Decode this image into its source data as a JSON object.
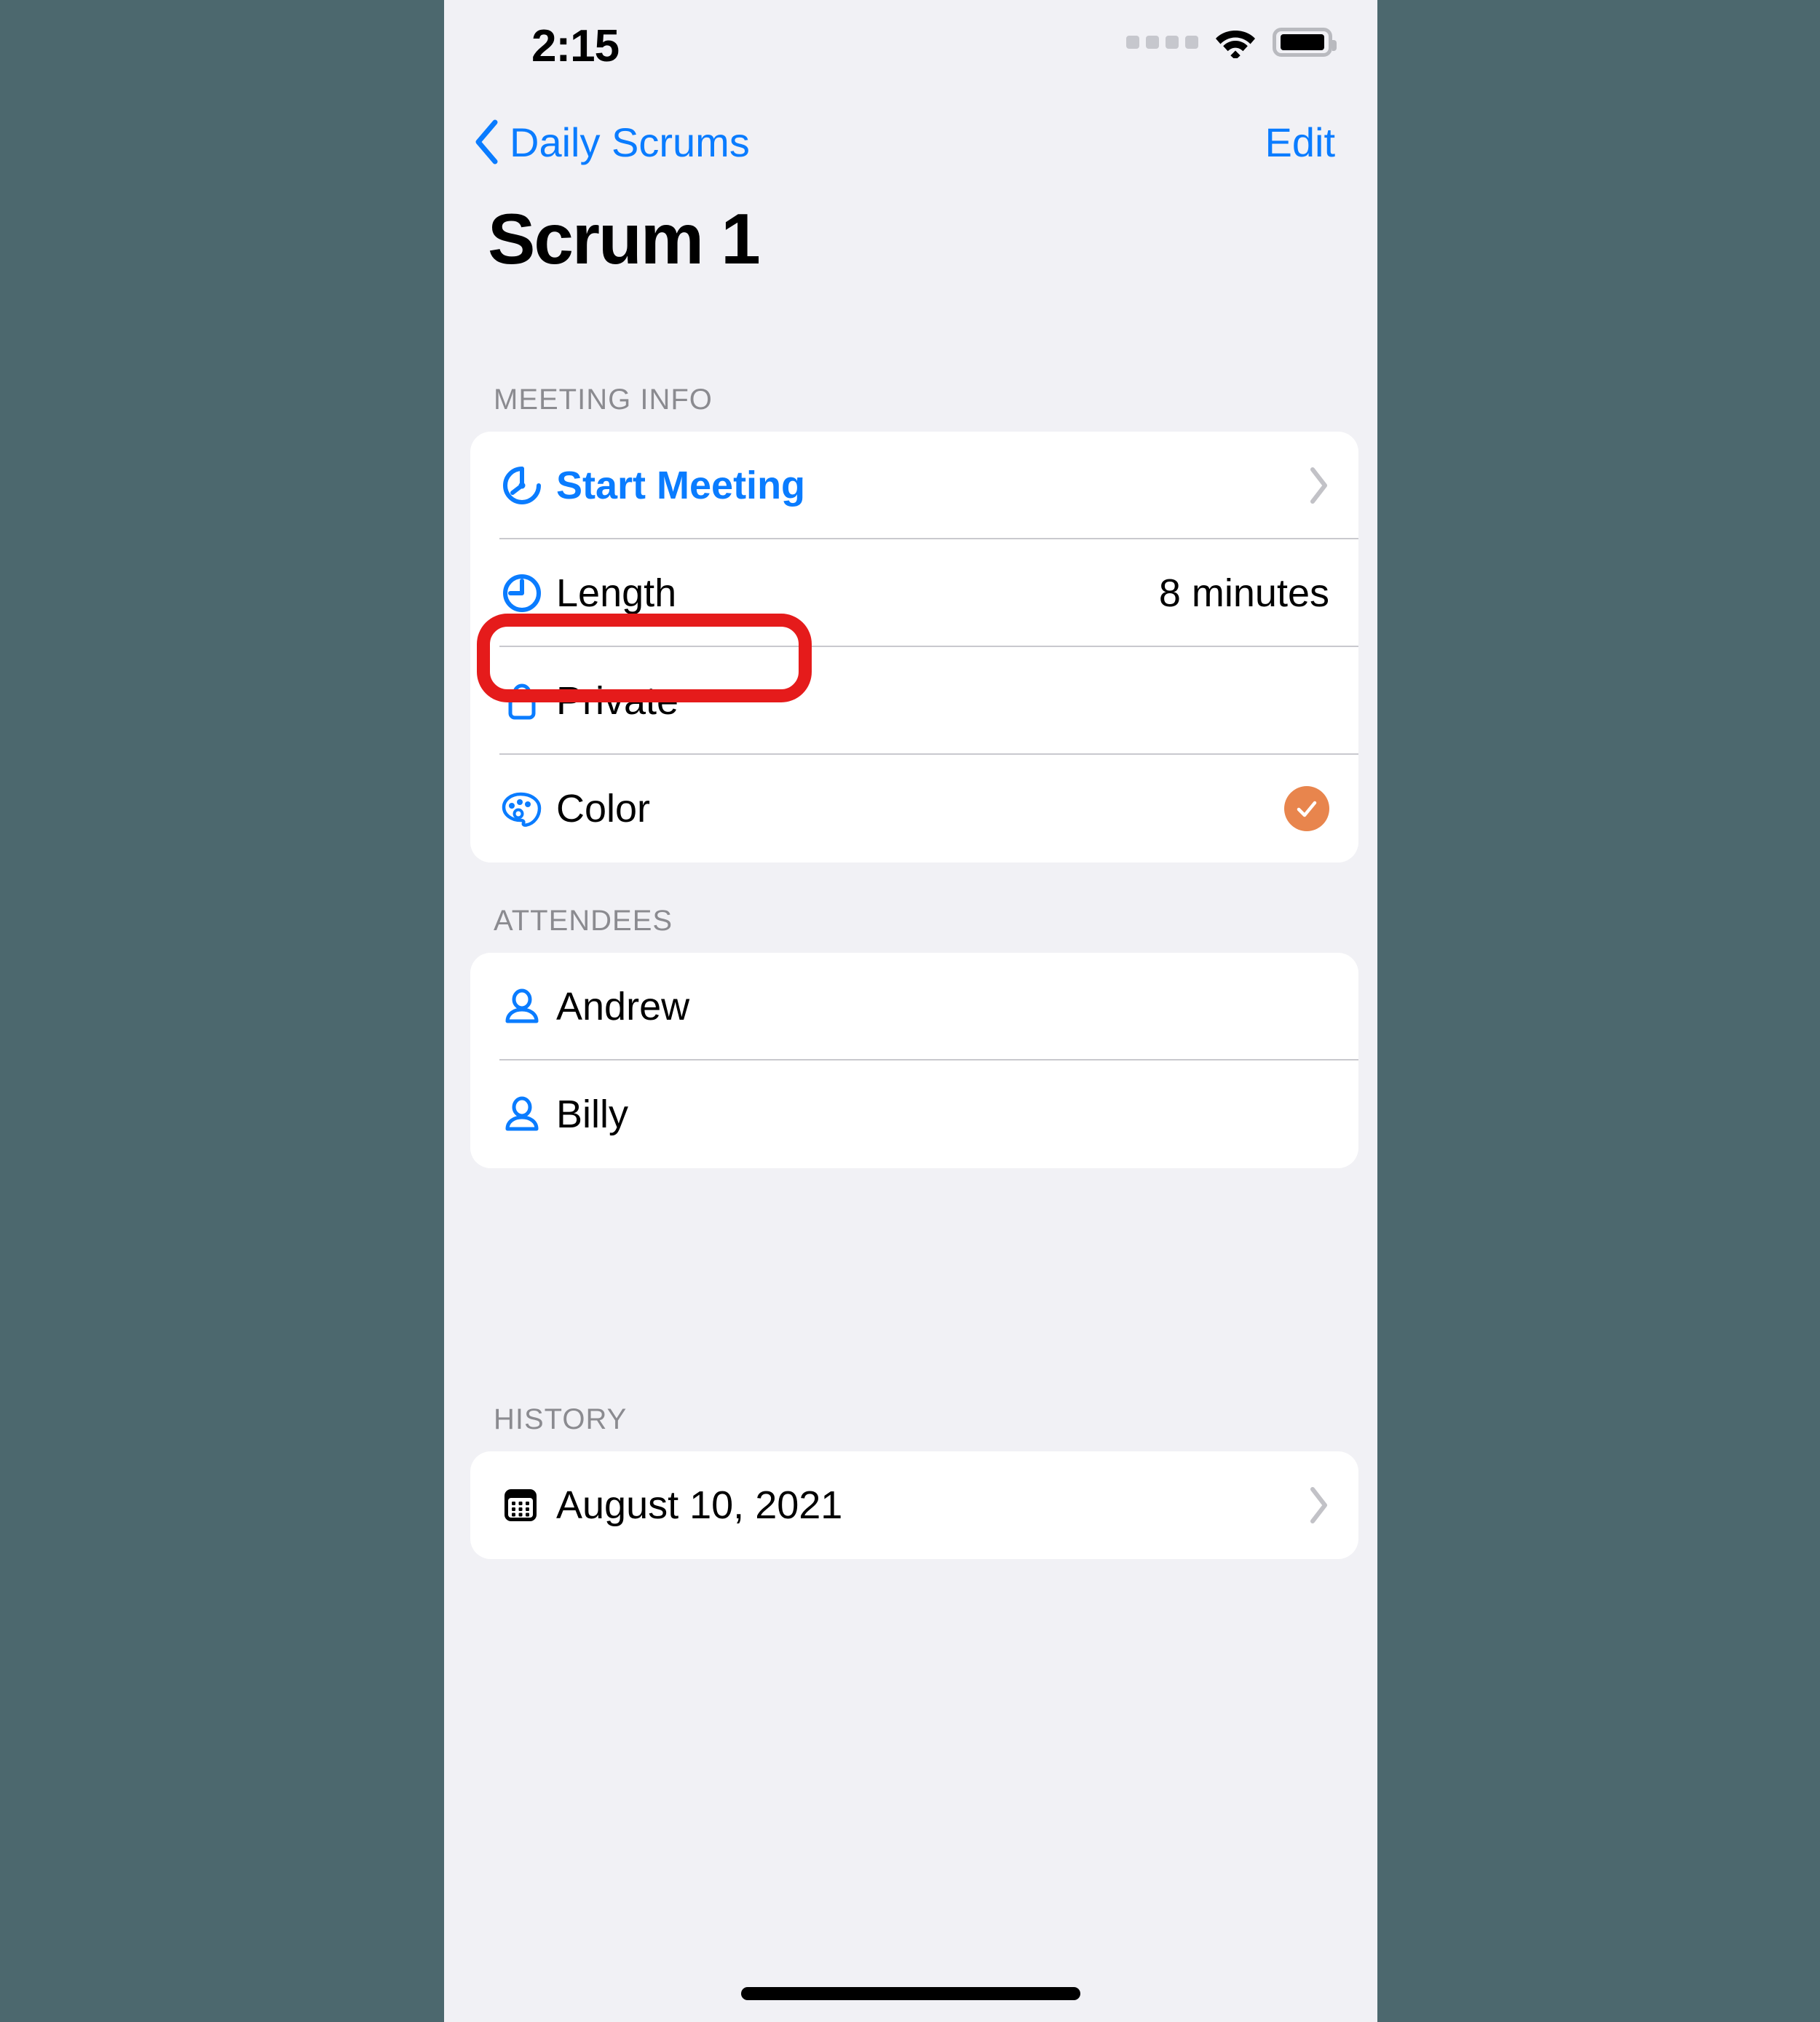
{
  "status_bar": {
    "time": "2:15",
    "signal_icon": "signal-dots-icon",
    "wifi_icon": "wifi-icon",
    "battery_icon": "battery-icon"
  },
  "nav_bar": {
    "back_label": "Daily Scrums",
    "back_icon": "chevron-left-icon",
    "edit_label": "Edit"
  },
  "page_title": "Scrum 1",
  "sections": [
    {
      "header": "MEETING INFO",
      "rows": [
        {
          "icon": "timer-icon",
          "label": "Start Meeting",
          "value": "",
          "accessory": "chevron-right-icon"
        },
        {
          "icon": "clock-icon",
          "label": "Length",
          "value": "8 minutes",
          "accessory": "none"
        },
        {
          "icon": "lock-icon",
          "label": "Private",
          "value": "",
          "accessory": "none"
        },
        {
          "icon": "palette-icon",
          "label": "Color",
          "value": "",
          "accessory": "color-swatch"
        }
      ]
    },
    {
      "header": "ATTENDEES",
      "rows": [
        {
          "icon": "person-icon",
          "label": "Andrew",
          "value": "",
          "accessory": "none"
        },
        {
          "icon": "person-icon",
          "label": "Billy",
          "value": "",
          "accessory": "none"
        }
      ]
    },
    {
      "header": "HISTORY",
      "rows": [
        {
          "icon": "calendar-icon",
          "label": "August 10, 2021",
          "value": "",
          "accessory": "chevron-right-icon"
        }
      ]
    }
  ],
  "annotation": {
    "target_row_label": "Private",
    "shape": "rounded-rectangle-highlight"
  },
  "colors": {
    "accent_blue": "#0a7cff",
    "color_swatch": "#e8854d",
    "annotation_red": "#e51b1b",
    "page_background": "#f1f1f5",
    "card_background": "#ffffff",
    "outer_background": "#4c686e",
    "section_header_text": "#8b8b90",
    "chevron_gray": "#c2c2c7"
  }
}
